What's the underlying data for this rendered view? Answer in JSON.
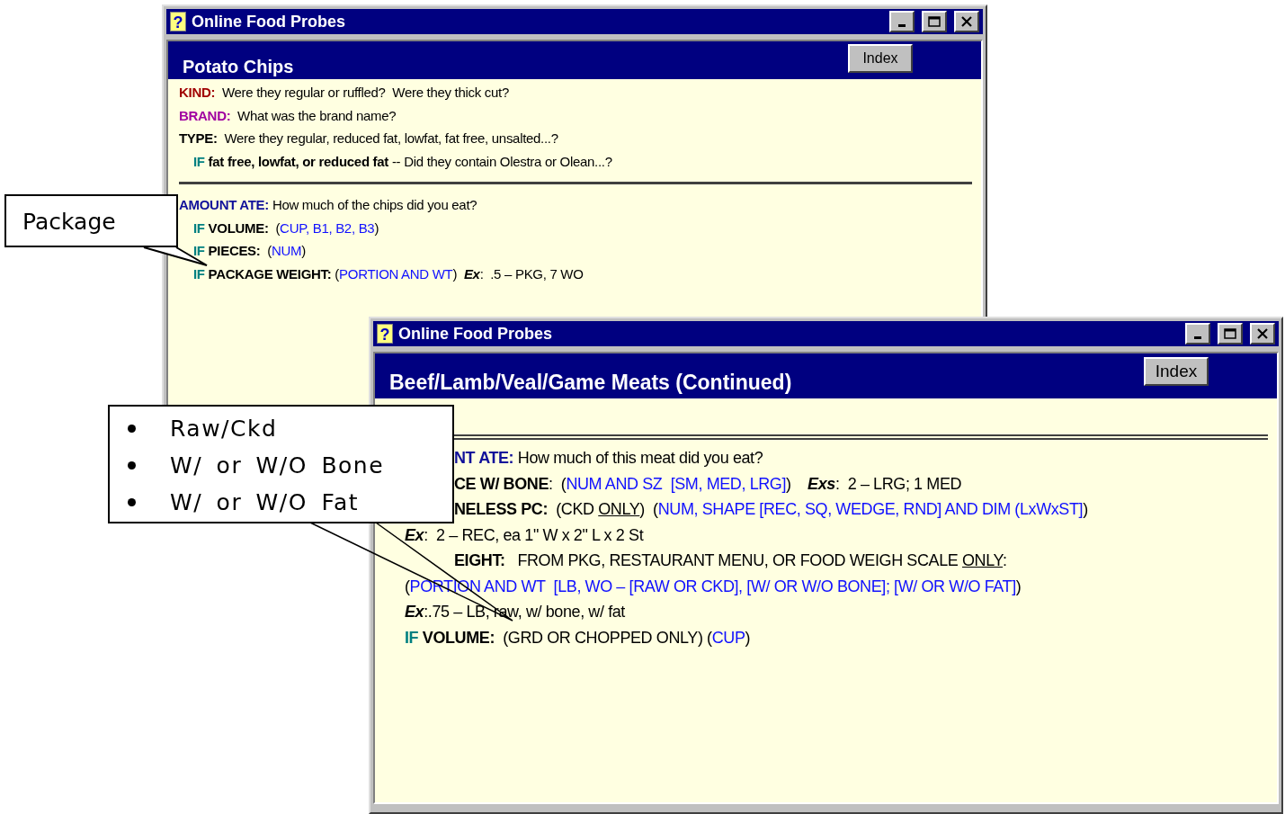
{
  "windows": [
    {
      "kind": "compact",
      "icon_glyph": "?",
      "title": "Online Food Probes",
      "heading": "Potato Chips",
      "index_button": "Index",
      "rows": [
        {
          "kind": "line",
          "indent": false,
          "clipped": false,
          "segments": [
            {
              "kind": "red_key",
              "text": "KIND:"
            },
            {
              "kind": "text",
              "text": "  Were they regular or ruffled?  Were they thick cut?"
            }
          ]
        },
        {
          "kind": "line",
          "indent": false,
          "clipped": false,
          "segments": [
            {
              "kind": "purple_key",
              "text": "BRAND:"
            },
            {
              "kind": "text",
              "text": "  What was the brand name?"
            }
          ]
        },
        {
          "kind": "line",
          "indent": false,
          "clipped": false,
          "segments": [
            {
              "kind": "key",
              "text": "TYPE:"
            },
            {
              "kind": "text",
              "text": "  Were they regular, reduced fat, lowfat, fat free, unsalted...?"
            }
          ]
        },
        {
          "kind": "line",
          "indent": true,
          "clipped": false,
          "segments": [
            {
              "kind": "if",
              "text": "IF"
            },
            {
              "kind": "bold",
              "text": " fat free, lowfat, or reduced fat"
            },
            {
              "kind": "text",
              "text": " -- Did they contain Olestra or Olean...?"
            }
          ]
        },
        {
          "kind": "rule"
        },
        {
          "kind": "line",
          "indent": false,
          "clipped": false,
          "segments": [
            {
              "kind": "navy_key",
              "text": "AMOUNT ATE:"
            },
            {
              "kind": "text",
              "text": " How much of the chips did you eat?"
            }
          ]
        },
        {
          "kind": "line",
          "indent": true,
          "clipped": false,
          "segments": [
            {
              "kind": "if",
              "text": "IF"
            },
            {
              "kind": "key",
              "text": " VOLUME:"
            },
            {
              "kind": "text",
              "text": "  ("
            },
            {
              "kind": "link",
              "text": "CUP, B1, B2, B3"
            },
            {
              "kind": "text",
              "text": ")"
            }
          ]
        },
        {
          "kind": "line",
          "indent": true,
          "clipped": false,
          "segments": [
            {
              "kind": "if",
              "text": "IF"
            },
            {
              "kind": "key",
              "text": " PIECES:"
            },
            {
              "kind": "text",
              "text": "  ("
            },
            {
              "kind": "link",
              "text": "NUM"
            },
            {
              "kind": "text",
              "text": ")"
            }
          ]
        },
        {
          "kind": "line",
          "indent": true,
          "clipped": false,
          "segments": [
            {
              "kind": "if",
              "text": "IF"
            },
            {
              "kind": "key",
              "text": " PACKAGE WEIGHT:"
            },
            {
              "kind": "text",
              "text": " ("
            },
            {
              "kind": "link",
              "text": "PORTION AND WT"
            },
            {
              "kind": "text",
              "text": ")  "
            },
            {
              "kind": "example",
              "text": "Ex"
            },
            {
              "kind": "text",
              "text": ":  .5 – PKG, 7 WO"
            }
          ]
        }
      ]
    },
    {
      "kind": "regular",
      "icon_glyph": "?",
      "title": "Online Food Probes",
      "heading": "Beef/Lamb/Veal/Game Meats (Continued)",
      "index_button": "Index",
      "rows": [
        {
          "kind": "double_rule"
        },
        {
          "kind": "line",
          "indent": false,
          "clipped": true,
          "segments": [
            {
              "kind": "navy_key",
              "text": "NT ATE:"
            },
            {
              "kind": "text",
              "text": " How much of this meat did you eat?"
            }
          ]
        },
        {
          "kind": "line",
          "indent": false,
          "clipped": true,
          "segments": [
            {
              "kind": "key",
              "text": "CE W/ BONE"
            },
            {
              "kind": "text",
              "text": ":  ("
            },
            {
              "kind": "link",
              "text": "NUM AND SZ  [SM, MED, LRG]"
            },
            {
              "kind": "text",
              "text": ")    "
            },
            {
              "kind": "example",
              "text": "Exs"
            },
            {
              "kind": "text",
              "text": ":  2 – LRG; 1 MED"
            }
          ]
        },
        {
          "kind": "line",
          "indent": false,
          "clipped": true,
          "segments": [
            {
              "kind": "key",
              "text": "NELESS PC:"
            },
            {
              "kind": "text",
              "text": "  (CKD "
            },
            {
              "kind": "underline",
              "text": "ONLY"
            },
            {
              "kind": "text",
              "text": ")  ("
            },
            {
              "kind": "link",
              "text": "NUM, SHAPE [REC, SQ, WEDGE, RND] AND DIM (LxWxST]"
            },
            {
              "kind": "text",
              "text": ")"
            }
          ]
        },
        {
          "kind": "line",
          "indent": false,
          "clipped": false,
          "segments": [
            {
              "kind": "example",
              "text": "Ex"
            },
            {
              "kind": "text",
              "text": ":  2 – REC, ea 1\" W x 2\" L x 2 St"
            }
          ]
        },
        {
          "kind": "line",
          "indent": false,
          "clipped": true,
          "segments": [
            {
              "kind": "key",
              "text": "EIGHT:"
            },
            {
              "kind": "text",
              "text": "   FROM PKG, RESTAURANT MENU, OR FOOD WEIGH SCALE "
            },
            {
              "kind": "underline",
              "text": "ONLY"
            },
            {
              "kind": "text",
              "text": ":"
            }
          ]
        },
        {
          "kind": "line",
          "indent": false,
          "clipped": false,
          "segments": [
            {
              "kind": "text",
              "text": "("
            },
            {
              "kind": "link",
              "text": "PORTION AND WT  [LB, WO – [RAW OR CKD], [W/ OR W/O BONE]; [W/ OR W/O FAT]"
            },
            {
              "kind": "text",
              "text": ")"
            }
          ]
        },
        {
          "kind": "line",
          "indent": false,
          "clipped": false,
          "segments": [
            {
              "kind": "example",
              "text": "Ex"
            },
            {
              "kind": "text",
              "text": ":.75 – LB, raw, w/ bone, w/ fat"
            }
          ]
        },
        {
          "kind": "line",
          "indent": false,
          "clipped": false,
          "segments": [
            {
              "kind": "if",
              "text": "IF"
            },
            {
              "kind": "key",
              "text": " VOLUME:"
            },
            {
              "kind": "text",
              "text": "  (GRD OR CHOPPED ONLY) ("
            },
            {
              "kind": "link",
              "text": "CUP"
            },
            {
              "kind": "text",
              "text": ")"
            }
          ]
        }
      ]
    }
  ],
  "callouts": [
    {
      "kind": "label",
      "text": "Package"
    },
    {
      "kind": "bullets",
      "items": [
        "Raw/Ckd",
        "W/ or W/O Bone",
        "W/ or W/O Fat"
      ]
    }
  ]
}
